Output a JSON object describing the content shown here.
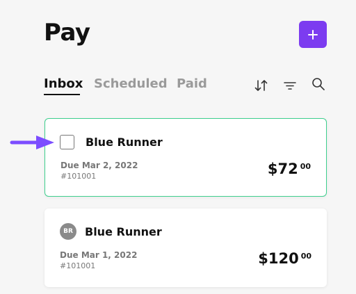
{
  "header": {
    "title": "Pay",
    "add_label": "+"
  },
  "tabs": [
    {
      "label": "Inbox",
      "active": true
    },
    {
      "label": "Scheduled",
      "active": false
    },
    {
      "label": "Paid",
      "active": false
    }
  ],
  "toolbar": {
    "icons": [
      "sort-icon",
      "filter-icon",
      "search-icon"
    ]
  },
  "bills": [
    {
      "payee": "Blue Runner",
      "due": "Due Mar 2, 2022",
      "ref": "#101001",
      "amount_main": "$72",
      "amount_cents": "00",
      "checkbox_shown": true
    },
    {
      "payee": "Blue Runner",
      "initials": "BR",
      "due": "Due Mar 1, 2022",
      "ref": "#101001",
      "amount_main": "$120",
      "amount_cents": "00",
      "checkbox_shown": false
    }
  ],
  "colors": {
    "accent": "#7c3cf0",
    "selected_border": "#3ecf8e",
    "arrow": "#7c4dff"
  }
}
